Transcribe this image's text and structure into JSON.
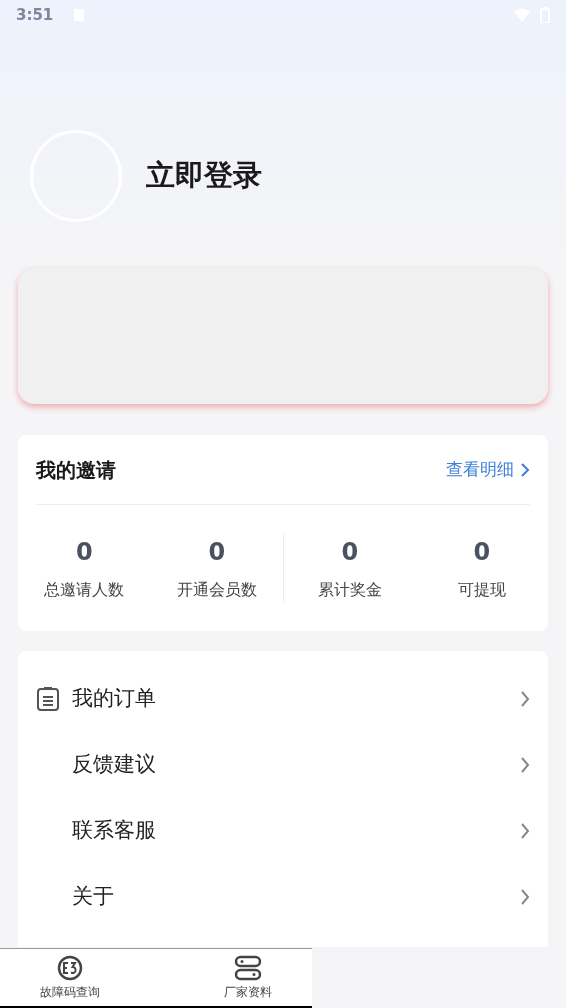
{
  "status_bar": {
    "time": "3:51"
  },
  "profile": {
    "login_label": "立即登录"
  },
  "invite": {
    "title": "我的邀请",
    "detail_link": "查看明细",
    "stats": [
      {
        "value": "0",
        "label": "总邀请人数"
      },
      {
        "value": "0",
        "label": "开通会员数"
      },
      {
        "value": "0",
        "label": "累计奖金"
      },
      {
        "value": "0",
        "label": "可提现"
      }
    ]
  },
  "menu": [
    {
      "label": "我的订单",
      "kind": "icon"
    },
    {
      "label": "反馈建议",
      "kind": "plain"
    },
    {
      "label": "联系客服",
      "kind": "plain"
    },
    {
      "label": "关于",
      "kind": "plain"
    }
  ],
  "bottom_nav": [
    {
      "label": "故障码查询",
      "kind": "code"
    },
    {
      "label": "厂家资料",
      "kind": "toggles"
    }
  ]
}
